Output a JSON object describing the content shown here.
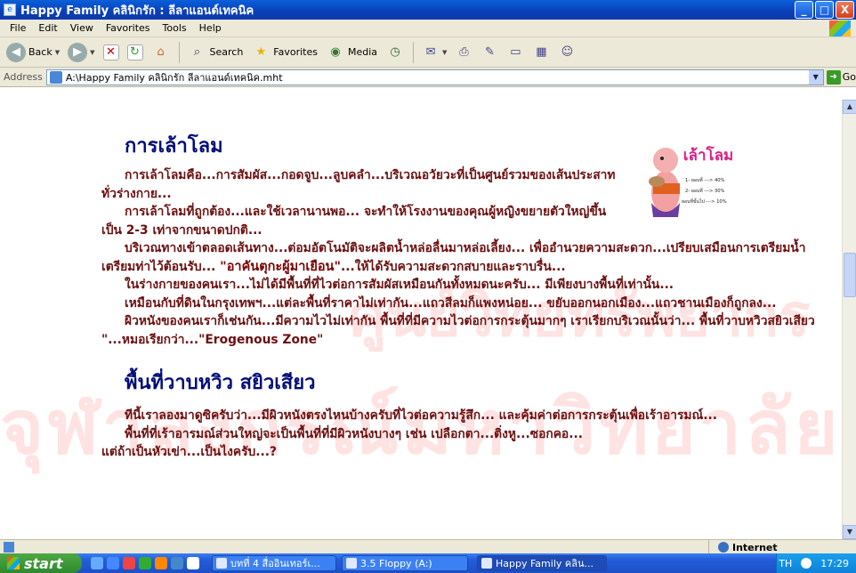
{
  "window": {
    "title": "Happy Family คลินิกรัก : ลีลาแอนด์เทคนิค",
    "controls": [
      "_",
      "□",
      "X"
    ]
  },
  "menu": [
    "File",
    "Edit",
    "View",
    "Favorites",
    "Tools",
    "Help"
  ],
  "toolbar": {
    "back": "Back",
    "search": "Search",
    "favorites": "Favorites",
    "media": "Media"
  },
  "address": {
    "label": "Address",
    "value": "A:\\Happy Family คลินิกรัก  ลีลาแอนด์เทคนิค.mht",
    "go": "Go"
  },
  "page": {
    "heading1": "การเล้าโลม",
    "intro": [
      "การเล้าโลมคือ...การสัมผัส...กอดจูบ...ลูบคลำ...บริเวณอวัยวะที่เป็นศูนย์รวมของเส้นประสาททั่วร่างกาย...",
      "การเล้าโลมที่ถูกต้อง...และใช้เวลานานพอ... จะทำให้โรงงานของคุณผู้หญิงขยายตัวใหญ่ขึ้น เป็น 2-3 เท่าจากขนาดปกติ..."
    ],
    "para3_a": "บริเวณทางเข้าตลอดเส้นทาง...ต่อมอัตโนมัติจะผลิตน้ำหล่อลื่นมาหล่อเลี้ยง... เพื่ออำนวยความสะดวก...เปรียบเสมือนการเตรียมน้ำเตรียมท่าไว้ต้อนรับ... ",
    "para3_quote": "\"อาคันตุกะผู้มาเยือน\"",
    "para3_b": "...ให้ได้รับความสะดวกสบายและราบรื่น...",
    "para4": "ในร่างกายของคนเรา...ไม่ได้มีพื้นที่ที่ไวต่อการสัมผัสเหมือนกันทั้งหมดนะครับ... มีเพียงบางพื้นที่เท่านั้น...",
    "para5": "เหมือนกับที่ดินในกรุงเทพฯ...แต่ละพื้นที่ราคาไม่เท่ากัน...แถวสีลมก็แพงหน่อย... ขยับออกนอกเมือง...แถวชานเมืองก็ถูกลง...",
    "para6": "ผิวหนังของคนเราก็เช่นกัน...มีความไวไม่เท่ากัน พื้นที่ที่มีความไวต่อการกระตุ้นมากๆ เราเรียกบริเวณนั้นว่า... พื้นที่วาบหวิวสยิวเสียว \"...หมอเรียกว่า...\"Erogenous Zone\"",
    "heading2": "พื้นที่วาบหวิว สยิวเสียว",
    "para7": "ทีนี้เราลองมาดูซิครับว่า...มีผิวหนังตรงไหนบ้างครับที่ไวต่อความรู้สึก... และคุ้มค่าต่อการกระตุ้นเพื่อเร้าอารมณ์...",
    "para8": "พื้นที่ที่เร้าอารมณ์ส่วนใหญ่จะเป็นพื้นที่ที่มีผิวหนังบางๆ เช่น เปลือกตา...ติ่งหู...ซอกคอ...",
    "para9": "แต่ถ้าเป็นหัวเข่า...เป็นไงครับ...?",
    "illustration": {
      "title": "เล้าโลม",
      "lines": [
        "1- ยอบที่ ---> 40%",
        "2- ยอบที่ ---> 30%",
        "ยอบที่ขั้นไป ---> 10%"
      ]
    },
    "watermark": [
      "ศูนย์วิทยทรัพยากร",
      "จุฬาลงกรณ์มหาวิทยาลัย"
    ]
  },
  "status": {
    "zone": "Internet"
  },
  "taskbar": {
    "start": "start",
    "tasks": [
      "บทที่ 4 สื่ออินเทอร์เ...",
      "3.5 Floppy (A:)",
      "Happy Family คลิน..."
    ],
    "lang": "TH",
    "time": "17:29"
  },
  "colors": {
    "heading": "#000d7a",
    "body_text": "#6b1010",
    "watermark": "#ffe2e2"
  }
}
